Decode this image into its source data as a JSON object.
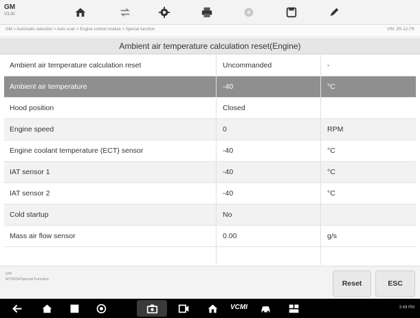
{
  "header": {
    "make": "GM",
    "version": "V3.30"
  },
  "toolbar_icons": [
    "home-icon",
    "vehicle-swap-icon",
    "settings-icon",
    "print-icon",
    "help-icon",
    "save-icon",
    "edit-icon"
  ],
  "breadcrumb": "GM > Automatic selection > Auto scan > Engine control module > Special function",
  "vin": "VIN: ZR-12-TR",
  "title": "Ambient air temperature calculation reset(Engine)",
  "rows": [
    {
      "name": "Ambient air temperature calculation reset",
      "value": "Uncommanded",
      "unit": "-"
    },
    {
      "name": "Ambient air temperature",
      "value": "-40",
      "unit": "°C"
    },
    {
      "name": "Hood position",
      "value": "Closed",
      "unit": ""
    },
    {
      "name": "Engine speed",
      "value": "0",
      "unit": "RPM"
    },
    {
      "name": "Engine coolant temperature (ECT) sensor",
      "value": "-40",
      "unit": "°C"
    },
    {
      "name": "IAT sensor 1",
      "value": "-40",
      "unit": "°C"
    },
    {
      "name": "IAT sensor 2",
      "value": "-40",
      "unit": "°C"
    },
    {
      "name": "Cold startup",
      "value": "No",
      "unit": ""
    },
    {
      "name": "Mass air flow sensor",
      "value": "0.00",
      "unit": "g/s"
    }
  ],
  "selected_row": 1,
  "footer": {
    "info_line1": "GM",
    "info_line2": "MY2009/Special Function",
    "reset_label": "Reset",
    "esc_label": "ESC"
  },
  "navbar": {
    "vci_label": "VCMI",
    "status": "3:49 PM"
  },
  "colors": {
    "selected_row": "#8f8f8f",
    "alt_row": "#f2f2f2",
    "title_bar": "#e6e6e6",
    "nav_bar": "#000000"
  }
}
